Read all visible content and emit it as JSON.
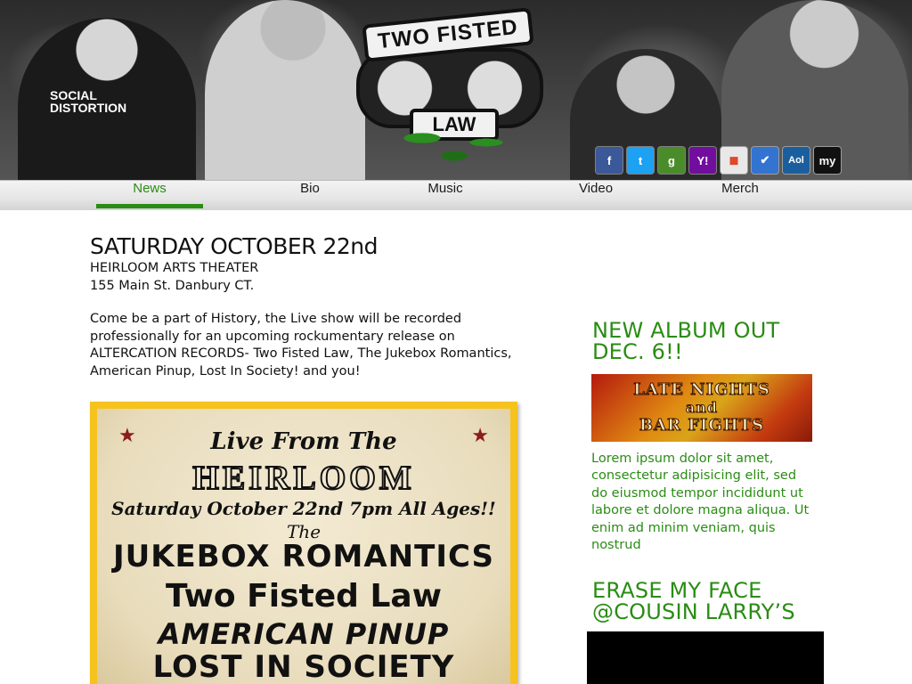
{
  "header": {
    "logo_text_top": "TWO FISTED",
    "logo_text_bottom": "LAW",
    "shirt_text": "SOCIAL\nDISTORTION"
  },
  "social_icons": [
    {
      "name": "facebook-icon",
      "label": "f",
      "color": "#3b5998"
    },
    {
      "name": "twitter-icon",
      "label": "t",
      "color": "#1da1f2"
    },
    {
      "name": "google-icon",
      "label": "g",
      "color": "#4a8c2a"
    },
    {
      "name": "yahoo-icon",
      "label": "Y!",
      "color": "#720e9e"
    },
    {
      "name": "windows-live-icon",
      "label": "◼",
      "color": "#e8e8e8"
    },
    {
      "name": "delicious-icon",
      "label": "✔",
      "color": "#3274d0"
    },
    {
      "name": "aol-icon",
      "label": "Aol",
      "color": "#1b5e9e"
    },
    {
      "name": "myspace-icon",
      "label": "my",
      "color": "#111111"
    }
  ],
  "nav": {
    "items": [
      {
        "label": "News",
        "active": true
      },
      {
        "label": "Bio",
        "active": false
      },
      {
        "label": "Music",
        "active": false
      },
      {
        "label": "Video",
        "active": false
      },
      {
        "label": "Merch",
        "active": false
      }
    ]
  },
  "event": {
    "title": "SATURDAY OCTOBER 22nd",
    "venue": "HEIRLOOM ARTS THEATER",
    "address": "155 Main St. Danbury CT.",
    "description": "Come be a part of History, the Live show will be recorded professionally for an upcoming rockumentary release on ALTERCATION RECORDS- Two Fisted Law, The Jukebox Romantics, American Pinup, Lost In Society! and you!"
  },
  "poster": {
    "line1": "Live From The",
    "line2": "HEIRLOOM",
    "line3": "Saturday October 22nd 7pm All Ages!!",
    "line4": "The",
    "line5": "JUKEBOX ROMANTICS",
    "line6": "Two Fisted Law",
    "line7": "AMERICAN PINUP",
    "line8": "LOST IN SOCIETY",
    "star": "★"
  },
  "sidebar": {
    "album_heading_1": "NEW ALBUM OUT",
    "album_heading_2": "DEC. 6!!",
    "album_cover_line1": "LATE NIGHTS",
    "album_cover_line2": "and",
    "album_cover_line3": "BAR FIGHTS",
    "lorem": "Lorem ipsum dolor sit amet, consectetur adipisicing elit, sed do eiusmod tempor incididunt ut labore et dolore magna aliqua. Ut enim ad minim veniam, quis nostrud",
    "video_heading_1": "ERASE MY FACE",
    "video_heading_2": "@COUSIN LARRY’S"
  },
  "colors": {
    "accent_green": "#2a8c14",
    "poster_border": "#f6c21e"
  }
}
